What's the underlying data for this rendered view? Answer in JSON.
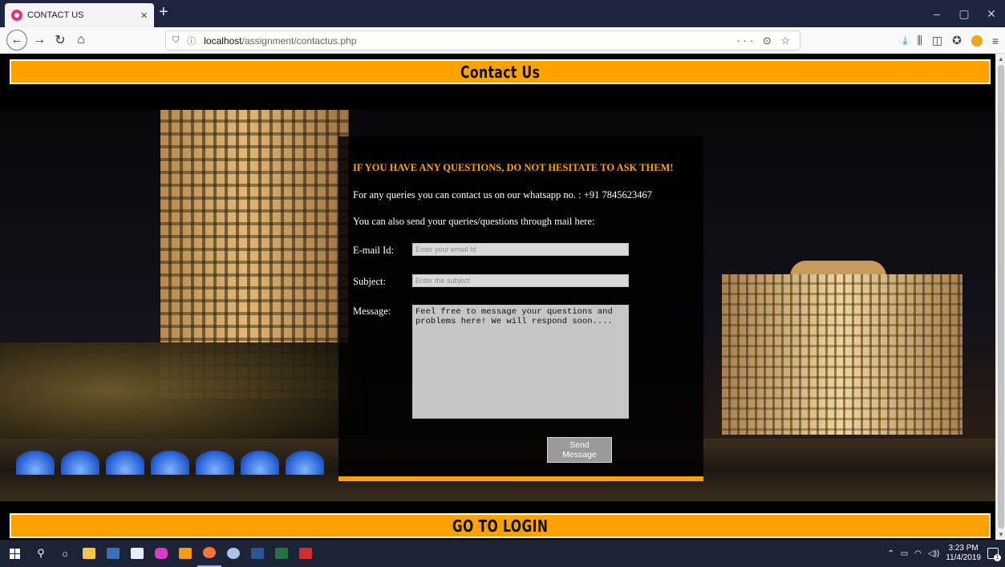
{
  "browser": {
    "tab_title": "CONTACT US",
    "tab_close": "×",
    "new_tab": "+",
    "url_host": "localhost",
    "url_path": "/assignment/contactus.php",
    "url_actions": "··· ⊙ ☆",
    "window_controls": [
      "–",
      "▢",
      "✕"
    ]
  },
  "page": {
    "header_title": "Contact Us",
    "footer_link": "GO TO LOGIN",
    "accent_color": "#ffa200"
  },
  "contact": {
    "heading": "IF YOU HAVE ANY QUESTIONS, DO NOT HESITATE TO ASK THEM!",
    "whatsapp_line": "For any queries you can contact us on our whatsapp no. : +91 7845623467",
    "mail_line": "You can also send your queries/questions through mail here:",
    "email_label": "E-mail Id:",
    "email_placeholder": "Enter your email Id",
    "subject_label": "Subject:",
    "subject_placeholder": "Enter the subject",
    "message_label": "Message:",
    "message_text": "Feel free to message your questions and problems here! We will respond soon....",
    "send_label": "Send Message"
  },
  "taskbar": {
    "time": "3:23 PM",
    "date": "11/4/2019",
    "notify_count": "1"
  }
}
